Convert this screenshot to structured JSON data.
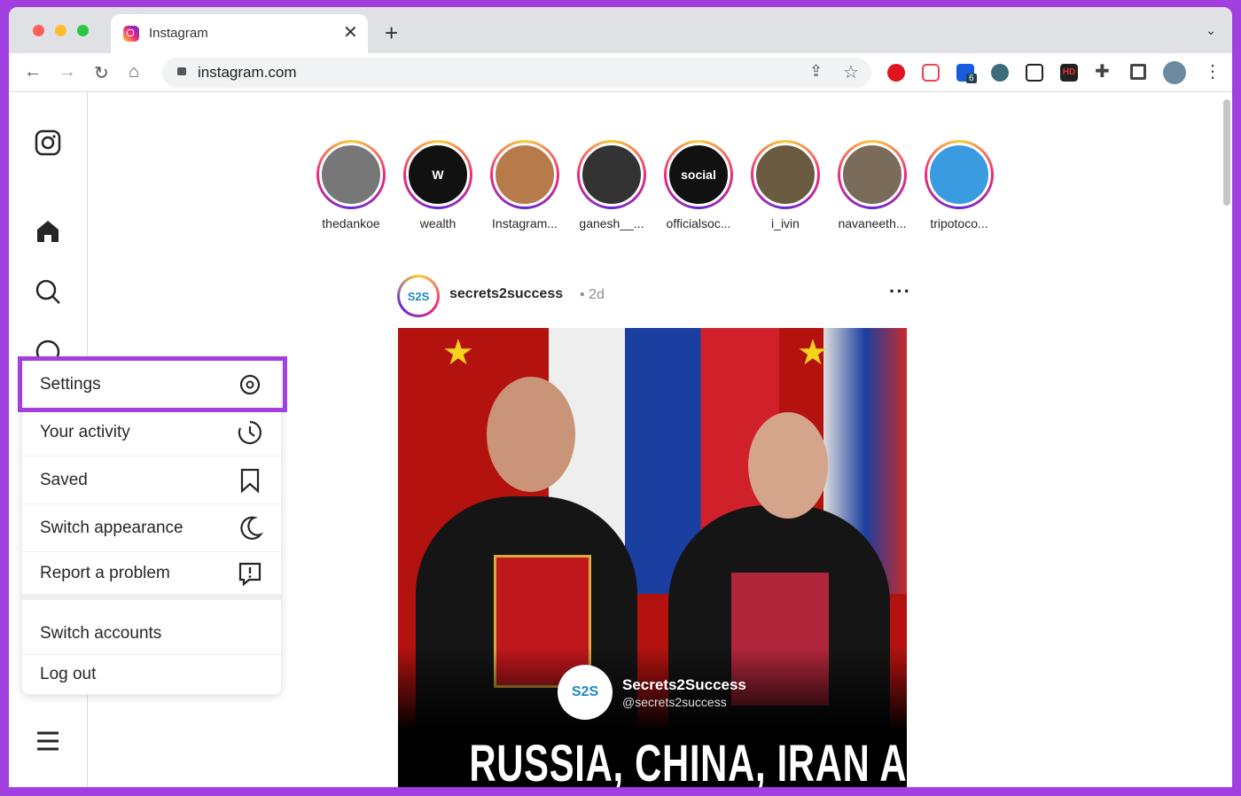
{
  "browser": {
    "tab_title": "Instagram",
    "url": "instagram.com",
    "extension_badge": "6",
    "hd_label": "HD",
    "icons": [
      "back-icon",
      "forward-icon",
      "reload-icon",
      "home-icon",
      "lock-icon",
      "share-icon",
      "star-icon",
      "adblock-icon",
      "pocket-icon",
      "bitwarden-icon",
      "spy-icon",
      "telegram-icon",
      "hd-icon",
      "puzzle-icon",
      "sidepanel-icon",
      "profile-avatar",
      "kebab-icon"
    ]
  },
  "sidebar": {
    "icons": [
      "instagram-logo-icon",
      "home-icon",
      "search-icon",
      "explore-icon",
      "hamburger-icon"
    ]
  },
  "stories": [
    {
      "name": "thedankoe",
      "color": "#777"
    },
    {
      "name": "wealth",
      "initial": "W",
      "color": "#111"
    },
    {
      "name": "Instagram...",
      "color": "#b77a4a"
    },
    {
      "name": "ganesh__...",
      "color": "#333"
    },
    {
      "name": "officialsoc...",
      "initial": "social",
      "color": "#111"
    },
    {
      "name": "i_ivin",
      "color": "#6a5a40"
    },
    {
      "name": "navaneeth...",
      "color": "#7a6b5a"
    },
    {
      "name": "tripotoco...",
      "color": "#3b9be0"
    }
  ],
  "post": {
    "username": "secrets2success",
    "time": "• 2d",
    "avatar_text": "S2S",
    "overlay_name": "Secrets2Success",
    "overlay_handle": "@secrets2success",
    "headline": "RUSSIA, CHINA, IRAN AND"
  },
  "menu": {
    "items": [
      {
        "label": "Settings",
        "icon": "settings-icon"
      },
      {
        "label": "Your activity",
        "icon": "activity-icon"
      },
      {
        "label": "Saved",
        "icon": "bookmark-icon"
      },
      {
        "label": "Switch appearance",
        "icon": "moon-icon"
      },
      {
        "label": "Report a problem",
        "icon": "report-icon"
      },
      {
        "label": "Switch accounts"
      },
      {
        "label": "Log out"
      }
    ]
  },
  "colors": {
    "highlight": "#a23fe0"
  }
}
